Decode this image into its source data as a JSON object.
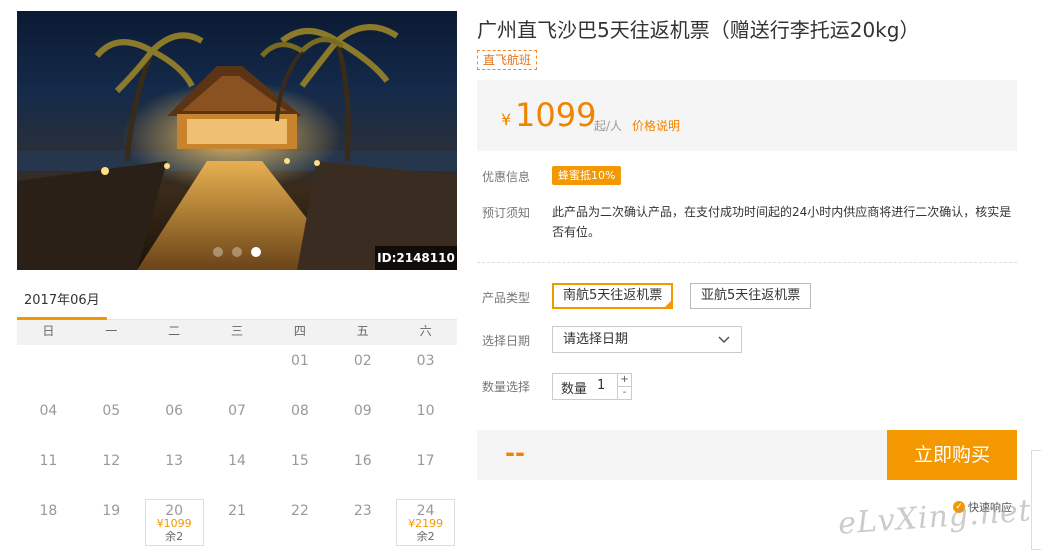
{
  "gallery": {
    "image_id": "ID:2148110",
    "dots": [
      false,
      false,
      true
    ]
  },
  "calendar": {
    "month_tab": "2017年06月",
    "weekdays": [
      "日",
      "一",
      "二",
      "三",
      "四",
      "五",
      "六"
    ],
    "rows": [
      [
        {
          "d": ""
        },
        {
          "d": ""
        },
        {
          "d": ""
        },
        {
          "d": ""
        },
        {
          "d": "01"
        },
        {
          "d": "02"
        },
        {
          "d": "03"
        }
      ],
      [
        {
          "d": "04"
        },
        {
          "d": "05"
        },
        {
          "d": "06"
        },
        {
          "d": "07"
        },
        {
          "d": "08"
        },
        {
          "d": "09"
        },
        {
          "d": "10"
        }
      ],
      [
        {
          "d": "11"
        },
        {
          "d": "12"
        },
        {
          "d": "13"
        },
        {
          "d": "14"
        },
        {
          "d": "15"
        },
        {
          "d": "16"
        },
        {
          "d": "17"
        }
      ],
      [
        {
          "d": "18"
        },
        {
          "d": "19"
        },
        {
          "d": "20",
          "price": "¥1099",
          "left": "余2"
        },
        {
          "d": "21"
        },
        {
          "d": "22"
        },
        {
          "d": "23"
        },
        {
          "d": "24",
          "price": "¥2199",
          "left": "余2"
        }
      ]
    ]
  },
  "product": {
    "title": "广州直飞沙巴5天往返机票（赠送行李托运20kg）",
    "tag": "直飞航班",
    "currency": "¥",
    "price": "1099",
    "unit": "起/人",
    "price_note": "价格说明"
  },
  "info": {
    "promo_label": "优惠信息",
    "promo_badge": "蜂蜜抵10%",
    "notice_label": "预订须知",
    "notice_text": "此产品为二次确认产品，在支付成功时间起的24小时内供应商将进行二次确认，核实是否有位。"
  },
  "options": {
    "type_label": "产品类型",
    "types": [
      "南航5天往返机票",
      "亚航5天往返机票"
    ],
    "selected_index": 0,
    "date_label": "选择日期",
    "date_placeholder": "请选择日期",
    "qty_label": "数量选择",
    "qty_inner_label": "数量",
    "qty_value": "1",
    "qty_plus": "+",
    "qty_minus": "-"
  },
  "checkout": {
    "total": "--",
    "buy_label": "立即购买",
    "fast_response": "快速响应"
  },
  "watermark": "eLvXing.net",
  "colors": {
    "accent": "#f39800",
    "price": "#f08300"
  }
}
